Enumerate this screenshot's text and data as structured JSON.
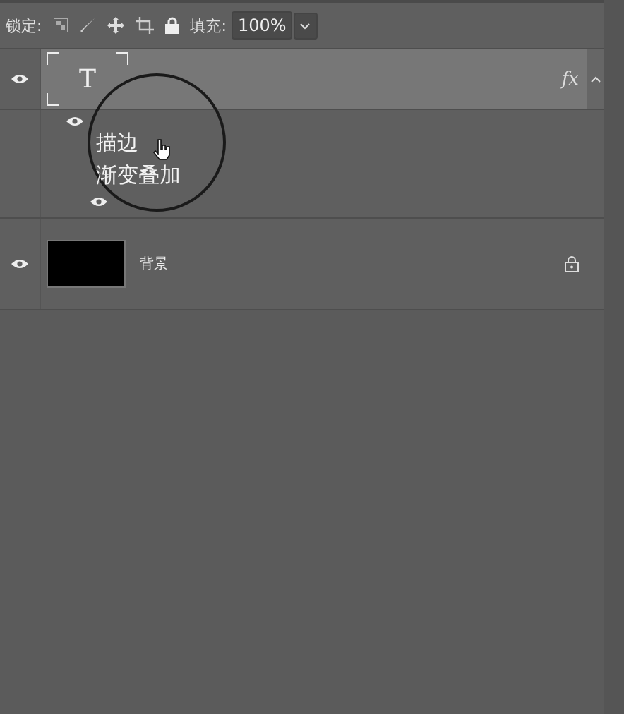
{
  "toolbar": {
    "lock_label": "锁定:",
    "fill_label": "填充:",
    "fill_value": "100%"
  },
  "layers": [
    {
      "kind": "text",
      "glyph": "T",
      "selected": true,
      "visible": true,
      "fx_label": "fx",
      "effects": [
        {
          "visible": true
        },
        {
          "visible": true
        }
      ]
    },
    {
      "kind": "fill",
      "name": "背景",
      "selected": false,
      "visible": true,
      "locked": true
    }
  ],
  "magnifier": {
    "items": [
      "描边",
      "渐变叠加"
    ]
  }
}
